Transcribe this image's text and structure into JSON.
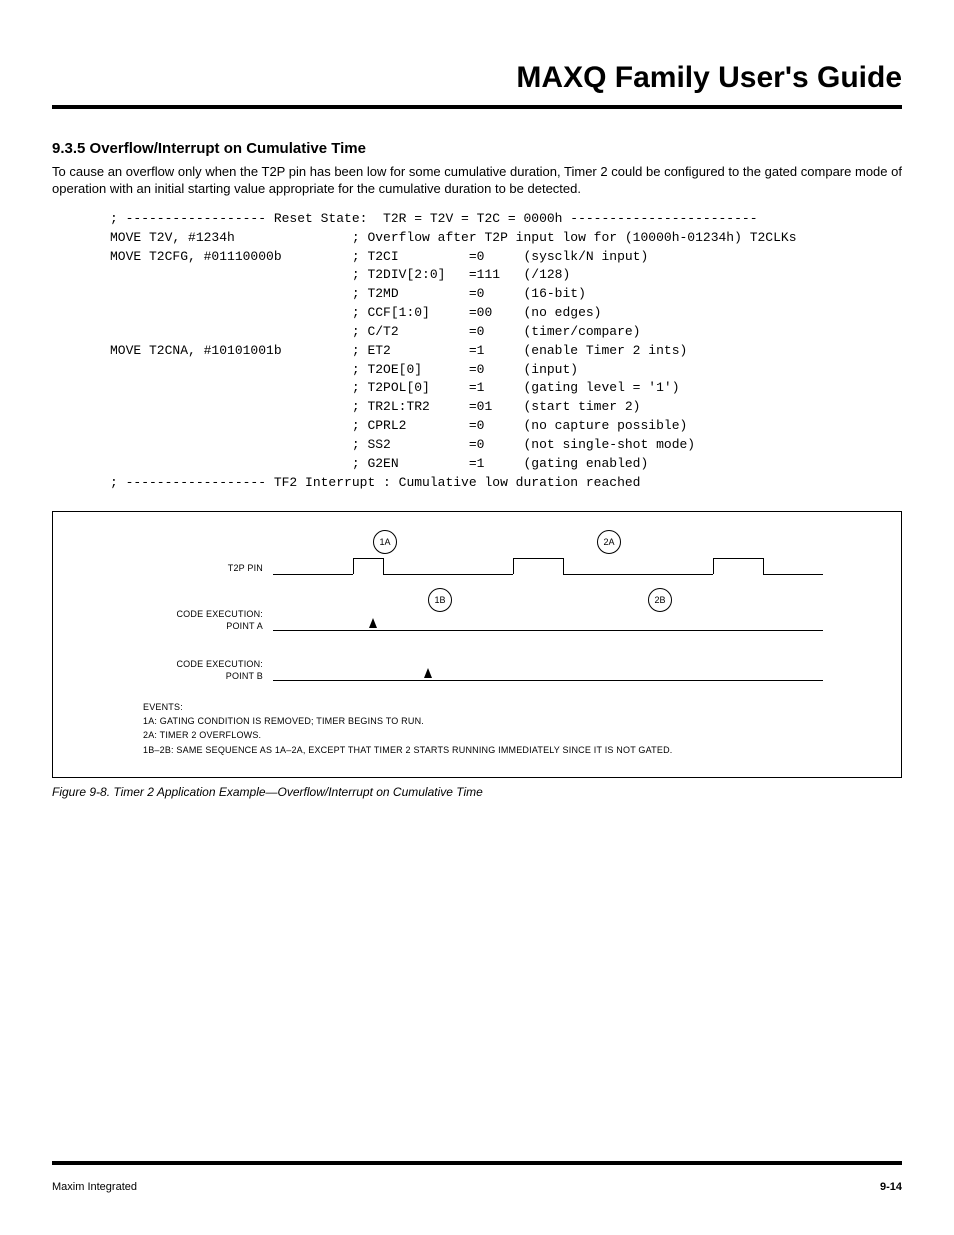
{
  "header": {
    "title": "MAXQ Family User's Guide"
  },
  "section": {
    "heading": "9.3.5 Overflow/Interrupt on Cumulative Time",
    "body": "To cause an overflow only when the T2P pin has been low for some cumulative duration, Timer 2 could be configured to the gated compare mode of operation with an initial starting value appropriate for the cumulative duration to be detected."
  },
  "code": "; ------------------ Reset State:  T2R = T2V = T2C = 0000h ------------------------\nMOVE T2V, #1234h               ; Overflow after T2P input low for (10000h-01234h) T2CLKs\nMOVE T2CFG, #01110000b         ; T2CI         =0     (sysclk/N input)\n                               ; T2DIV[2:0]   =111   (/128)\n                               ; T2MD         =0     (16-bit)\n                               ; CCF[1:0]     =00    (no edges)\n                               ; C/T2         =0     (timer/compare)\nMOVE T2CNA, #10101001b         ; ET2          =1     (enable Timer 2 ints)\n                               ; T2OE[0]      =0     (input)\n                               ; T2POL[0]     =1     (gating level = '1')\n                               ; TR2L:TR2     =01    (start timer 2)\n                               ; CPRL2        =0     (no capture possible)\n                               ; SS2          =0     (not single-shot mode)\n                               ; G2EN         =1     (gating enabled)\n; ------------------ TF2 Interrupt : Cumulative low duration reached",
  "figure": {
    "labels": {
      "t2p": "T2P PIN",
      "pointA": "CODE EXECUTION:\nPOINT A",
      "pointB": "CODE EXECUTION:\nPOINT B",
      "n1a": "1A",
      "n2a": "2A",
      "n1b": "1B",
      "n2b": "2B"
    },
    "events": {
      "title": "EVENTS:",
      "e1": "1A: GATING CONDITION IS REMOVED; TIMER BEGINS TO RUN.",
      "e2": "2A: TIMER 2 OVERFLOWS.",
      "e3": "1B–2B: SAME SEQUENCE AS 1A–2A, EXCEPT THAT TIMER 2 STARTS RUNNING IMMEDIATELY SINCE IT IS NOT GATED."
    },
    "caption": "Figure 9-8. Timer 2 Application Example—Overflow/Interrupt on Cumulative Time"
  },
  "footer": {
    "left": "Maxim Integrated",
    "right": "9-14"
  }
}
